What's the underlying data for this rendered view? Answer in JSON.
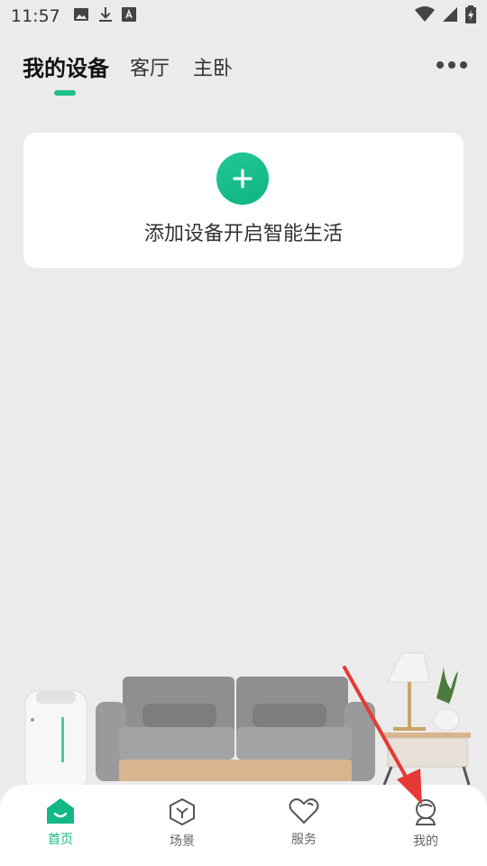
{
  "status_bar": {
    "time": "11:57",
    "icons_left": [
      "image-icon",
      "download-icon",
      "text-a-icon"
    ],
    "icons_right": [
      "wifi-icon",
      "signal-icon",
      "battery-charging-icon"
    ]
  },
  "tabs": [
    {
      "label": "我的设备",
      "active": true
    },
    {
      "label": "客厅",
      "active": false
    },
    {
      "label": "主卧",
      "active": false
    }
  ],
  "more_icon": "more-horizontal-icon",
  "add_card": {
    "label": "添加设备开启智能生活",
    "icon": "plus-icon"
  },
  "bottom_nav": [
    {
      "label": "首页",
      "icon": "home-icon",
      "active": true
    },
    {
      "label": "场景",
      "icon": "scene-icon",
      "active": false
    },
    {
      "label": "服务",
      "icon": "heart-icon",
      "active": false
    },
    {
      "label": "我的",
      "icon": "profile-icon",
      "active": false
    }
  ],
  "colors": {
    "accent": "#12b886",
    "background": "#ebebeb",
    "annotation_arrow": "#e53935"
  }
}
